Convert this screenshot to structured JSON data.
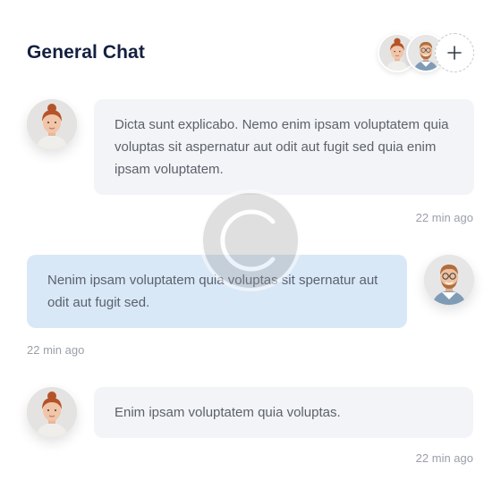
{
  "header": {
    "title": "General Chat",
    "add_participant_icon": "plus-icon"
  },
  "messages": [
    {
      "sender": "woman",
      "side": "left",
      "text": "Dicta sunt explicabo. Nemo enim ipsam voluptatem quia voluptas sit aspernatur aut odit aut fugit sed quia enim ipsam voluptatem.",
      "time": "22 min ago",
      "bubble_color": "#f3f4f7"
    },
    {
      "sender": "man",
      "side": "right",
      "text": "Nenim ipsam voluptatem quia voluptas sit spernatur aut odit aut fugit sed.",
      "time": "22 min ago",
      "bubble_color": "#d9e8f7"
    },
    {
      "sender": "woman",
      "side": "left",
      "text": "Enim ipsam voluptatem quia voluptas.",
      "time": "22 min ago",
      "bubble_color": "#f3f4f7"
    }
  ],
  "colors": {
    "title": "#14203f",
    "text": "#5c616c",
    "timestamp": "#9aa0a9",
    "received_bubble": "#f3f4f7",
    "sent_bubble": "#d9e8f7"
  },
  "watermark_icon": "copyright-icon"
}
